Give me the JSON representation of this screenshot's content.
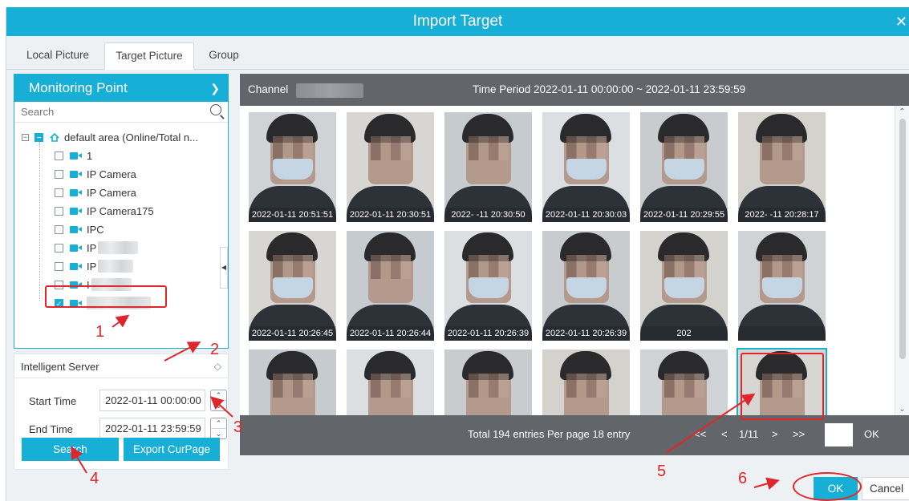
{
  "dialog": {
    "title": "Import Target",
    "close_glyph": "✕"
  },
  "tabs": [
    "Local Picture",
    "Target Picture",
    "Group"
  ],
  "active_tab": "Target Picture",
  "monitoring": {
    "header": "Monitoring Point",
    "search_placeholder": "Search",
    "root": "default area (Online/Total n...",
    "items": [
      "1",
      "IP Camera",
      "IP Camera",
      "IP Camera175",
      "IPC",
      "IP",
      "IP",
      "I",
      ""
    ]
  },
  "server": {
    "label": "Intelligent Server"
  },
  "time": {
    "start_label": "Start Time",
    "start_value": "2022-01-11 00:00:00",
    "end_label": "End Time",
    "end_value": "2022-01-11 23:59:59"
  },
  "buttons": {
    "search": "Search",
    "export": "Export CurPage",
    "ok": "OK",
    "cancel": "Cancel"
  },
  "filter": {
    "channel_label": "Channel",
    "time_period": "Time Period  2022-01-11 00:00:00  ~  2022-01-11 23:59:59"
  },
  "thumbnails": [
    "2022-01-11 20:51:51",
    "2022-01-11 20:30:51",
    "2022-  -11 20:30:50",
    "2022-01-11 20:30:03",
    "2022-01-11 20:29:55",
    "2022-  -11 20:28:17",
    "2022-01-11 20:26:45",
    "2022-01-11 20:26:44",
    "2022-01-11 20:26:39",
    "2022-01-11 20:26:39",
    "202",
    "",
    "",
    "",
    "",
    "",
    "",
    ""
  ],
  "pager": {
    "summary": "Total 194 entries  Per page 18 entry",
    "first": "<<",
    "prev": "<",
    "page": "1/11",
    "next": ">",
    "last": ">>",
    "go": "OK"
  },
  "annotations": [
    "1",
    "2",
    "3",
    "4",
    "5",
    "6"
  ],
  "colors": {
    "accent": "#17afd6",
    "bar": "#62666a",
    "annotation": "#e0262a"
  }
}
